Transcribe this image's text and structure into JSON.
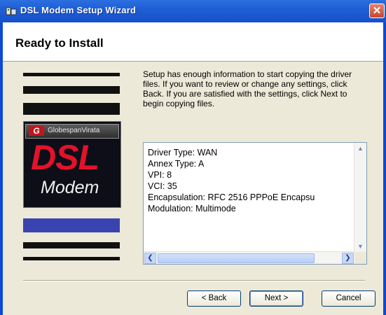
{
  "window": {
    "title": "DSL Modem Setup Wizard",
    "close_glyph": "✕"
  },
  "header": {
    "title": "Ready to Install"
  },
  "logo": {
    "brand": "GlobespanVirata",
    "brand_mark": "G",
    "product_line1": "DSL",
    "product_line2": "Modem"
  },
  "description": "Setup has enough information to start copying the driver files.  If you want to review or change any settings, click Back.  If you are satisfied with the settings, click Next to begin copying files.",
  "settings": [
    "Driver Type: WAN",
    "Annex Type: A",
    "VPI: 8",
    "VCI: 35",
    "Encapsulation: RFC 2516 PPPoE Encapsu",
    "Modulation: Multimode"
  ],
  "scroll": {
    "up": "▲",
    "down": "▼",
    "left": "❮",
    "right": "❯"
  },
  "buttons": {
    "back": "< Back",
    "next": "Next >",
    "cancel": "Cancel"
  },
  "colors": {
    "titlebar": "#1f5fd6",
    "logo_red": "#e3122a",
    "accent_blue": "#3a44b0"
  }
}
